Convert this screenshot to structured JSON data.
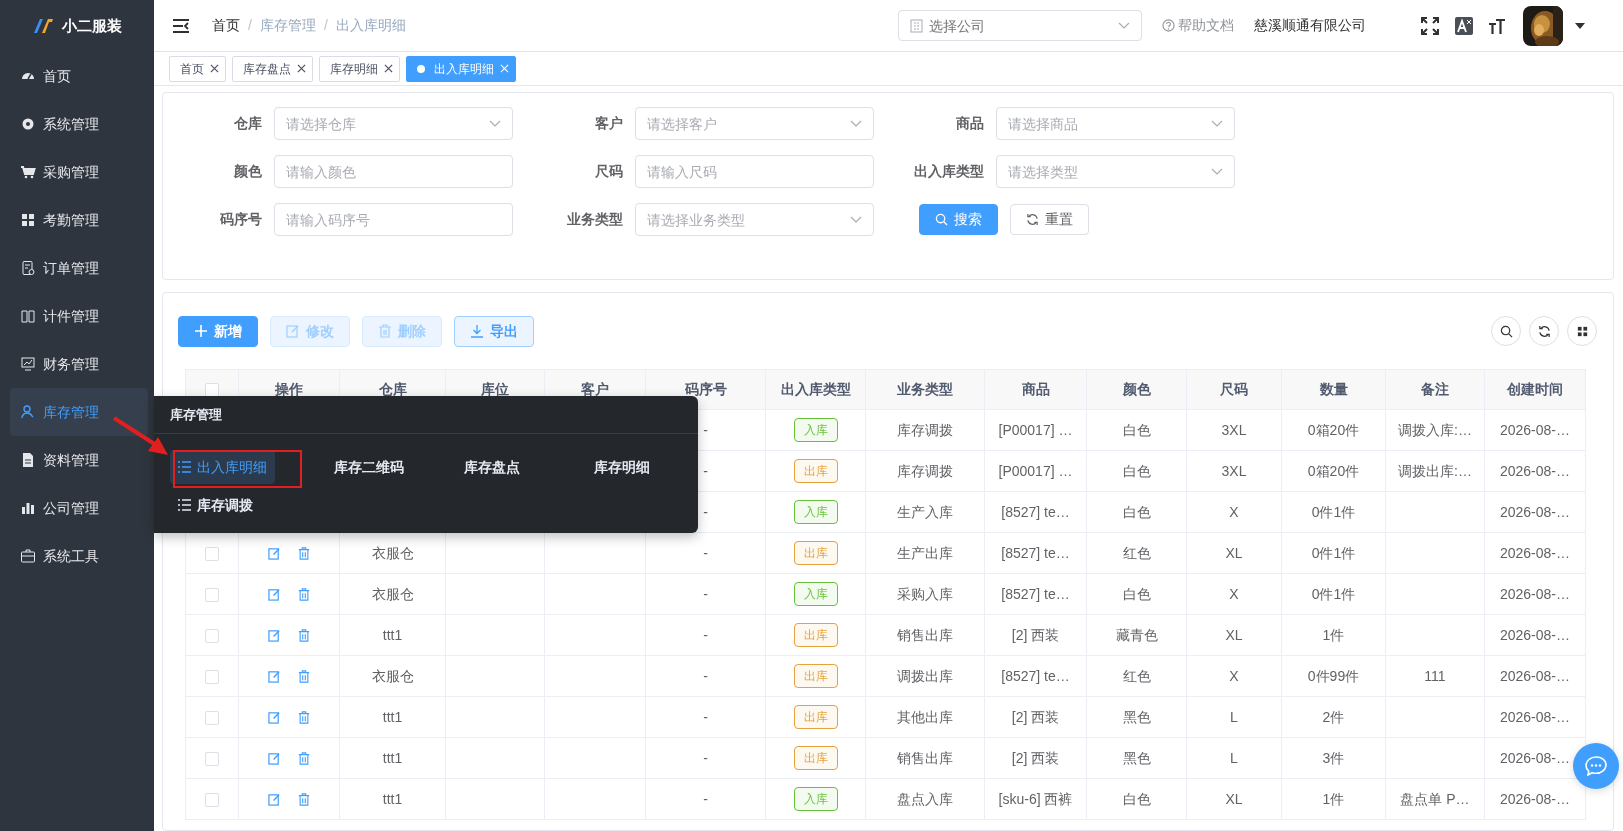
{
  "brand": {
    "name": "小二服装"
  },
  "sidebar": {
    "items": [
      {
        "label": "首页",
        "selected": false
      },
      {
        "label": "系统管理",
        "selected": false
      },
      {
        "label": "采购管理",
        "selected": false
      },
      {
        "label": "考勤管理",
        "selected": false
      },
      {
        "label": "订单管理",
        "selected": false
      },
      {
        "label": "计件管理",
        "selected": false
      },
      {
        "label": "财务管理",
        "selected": false
      },
      {
        "label": "库存管理",
        "selected": true
      },
      {
        "label": "资料管理",
        "selected": false
      },
      {
        "label": "公司管理",
        "selected": false
      },
      {
        "label": "系统工具",
        "selected": false
      }
    ]
  },
  "header": {
    "breadcrumb": [
      "首页",
      "库存管理",
      "出入库明细"
    ],
    "separator": "/",
    "company_select": {
      "placeholder": "选择公司"
    },
    "help": "帮助文档",
    "company": "慈溪顺通有限公司"
  },
  "tags": [
    {
      "label": "首页",
      "selected": false
    },
    {
      "label": "库存盘点",
      "selected": false
    },
    {
      "label": "库存明细",
      "selected": false
    },
    {
      "label": "出入库明细",
      "selected": true
    }
  ],
  "filters": [
    {
      "label": "仓库",
      "kind": "select",
      "placeholder": "请选择仓库"
    },
    {
      "label": "客户",
      "kind": "select",
      "placeholder": "请选择客户"
    },
    {
      "label": "商品",
      "kind": "select",
      "placeholder": "请选择商品"
    },
    {
      "label": "颜色",
      "kind": "input",
      "placeholder": "请输入颜色"
    },
    {
      "label": "尺码",
      "kind": "input",
      "placeholder": "请输入尺码"
    },
    {
      "label": "出入库类型",
      "kind": "select",
      "placeholder": "请选择类型"
    },
    {
      "label": "码序号",
      "kind": "input",
      "placeholder": "请输入码序号"
    },
    {
      "label": "业务类型",
      "kind": "select",
      "placeholder": "请选择业务类型"
    }
  ],
  "filter_buttons": [
    {
      "label": "搜索",
      "kind": "primary"
    },
    {
      "label": "重置",
      "kind": "plain"
    }
  ],
  "toolbar": {
    "buttons": [
      {
        "label": "新增",
        "kind": "add",
        "disabled": false
      },
      {
        "label": "修改",
        "kind": "edit",
        "disabled": true
      },
      {
        "label": "删除",
        "kind": "delete",
        "disabled": true
      },
      {
        "label": "导出",
        "kind": "export",
        "disabled": false
      }
    ]
  },
  "table": {
    "select_all": {
      "checked": false
    },
    "columns": [
      "操作",
      "仓库",
      "库位",
      "客户",
      "码序号",
      "出入库类型",
      "业务类型",
      "商品",
      "颜色",
      "尺码",
      "数量",
      "备注",
      "创建时间"
    ],
    "rows": [
      {
        "code": "-",
        "type": {
          "text": "入库",
          "color": "#67c23a"
        },
        "business": "库存调拨",
        "goods": "[P00017] …",
        "product_color": "白色",
        "size": "3XL",
        "qty": "0箱20件",
        "note": "调拨入库:…",
        "created": "2026-08-…"
      },
      {
        "code": "-",
        "type": {
          "text": "出库",
          "color": "#e6a23c"
        },
        "business": "库存调拨",
        "goods": "[P00017] …",
        "product_color": "白色",
        "size": "3XL",
        "qty": "0箱20件",
        "note": "调拨出库:…",
        "created": "2026-08-…"
      },
      {
        "code": "-",
        "type": {
          "text": "入库",
          "color": "#67c23a"
        },
        "business": "生产入库",
        "goods": "[8527] te…",
        "product_color": "白色",
        "size": "X",
        "qty": "0件1件",
        "created": "2026-08-…"
      },
      {
        "checked": false,
        "warehouse": "衣服仓",
        "code": "-",
        "type": {
          "text": "出库",
          "color": "#e6a23c"
        },
        "business": "生产出库",
        "goods": "[8527] te…",
        "product_color": "红色",
        "size": "XL",
        "qty": "0件1件",
        "created": "2026-08-…"
      },
      {
        "checked": false,
        "warehouse": "衣服仓",
        "code": "-",
        "type": {
          "text": "入库",
          "color": "#67c23a"
        },
        "business": "采购入库",
        "goods": "[8527] te…",
        "product_color": "白色",
        "size": "X",
        "qty": "0件1件",
        "created": "2026-08-…"
      },
      {
        "checked": false,
        "warehouse": "ttt1",
        "code": "-",
        "type": {
          "text": "出库",
          "color": "#e6a23c"
        },
        "business": "销售出库",
        "goods": "[2] 西装",
        "product_color": "藏青色",
        "size": "XL",
        "qty": "1件",
        "created": "2026-08-…"
      },
      {
        "checked": false,
        "warehouse": "衣服仓",
        "code": "-",
        "type": {
          "text": "出库",
          "color": "#e6a23c"
        },
        "business": "调拨出库",
        "goods": "[8527] te…",
        "product_color": "红色",
        "size": "X",
        "qty": "0件99件",
        "note": "111",
        "created": "2026-08-…"
      },
      {
        "checked": false,
        "warehouse": "ttt1",
        "code": "-",
        "type": {
          "text": "出库",
          "color": "#e6a23c"
        },
        "business": "其他出库",
        "goods": "[2] 西装",
        "product_color": "黑色",
        "size": "L",
        "qty": "2件",
        "created": "2026-08-…"
      },
      {
        "checked": false,
        "warehouse": "ttt1",
        "code": "-",
        "type": {
          "text": "出库",
          "color": "#e6a23c"
        },
        "business": "销售出库",
        "goods": "[2] 西装",
        "product_color": "黑色",
        "size": "L",
        "qty": "3件",
        "created": "2026-08-…"
      },
      {
        "checked": false,
        "warehouse": "ttt1",
        "code": "-",
        "type": {
          "text": "入库",
          "color": "#67c23a"
        },
        "business": "盘点入库",
        "goods": "[sku-6] 西裤",
        "product_color": "白色",
        "size": "XL",
        "qty": "1件",
        "note": "盘点单 P…",
        "created": "2026-08-…"
      }
    ]
  },
  "popup": {
    "title": "库存管理",
    "items": [
      {
        "label": "出入库明细",
        "kind": "icon",
        "selected": true
      },
      {
        "label": "库存二维码",
        "kind": "plain",
        "selected": false
      },
      {
        "label": "库存盘点",
        "kind": "plain",
        "selected": false
      },
      {
        "label": "库存明细",
        "kind": "plain",
        "selected": false
      },
      {
        "label": "库存调拨",
        "kind": "icon",
        "selected": false
      }
    ]
  }
}
